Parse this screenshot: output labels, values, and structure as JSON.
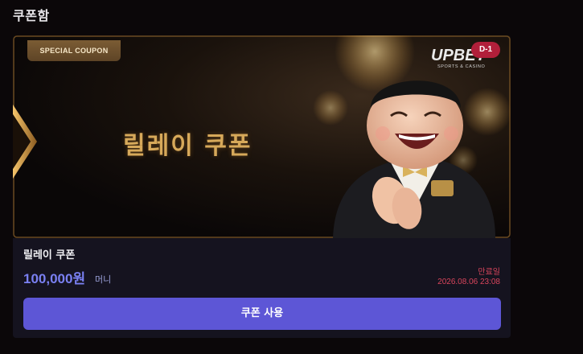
{
  "page": {
    "title": "쿠폰함"
  },
  "coupon": {
    "badge": "SPECIAL COUPON",
    "banner_title": "릴레이 쿠폰",
    "logo": {
      "name": "UPBET",
      "tagline": "SPORTS & CASINO"
    },
    "dday": "D-1",
    "name": "릴레이 쿠폰",
    "amount": "100,000원",
    "amount_unit": "머니",
    "expire_label": "만료일",
    "expire_date": "2026.08.06 23:08",
    "use_button_label": "쿠폰 사용"
  },
  "colors": {
    "accent": "#5d56d6",
    "amount": "#7a80f2",
    "expire": "#d9455c",
    "gold": "#d7a95a",
    "dday": "#b11f3a"
  }
}
